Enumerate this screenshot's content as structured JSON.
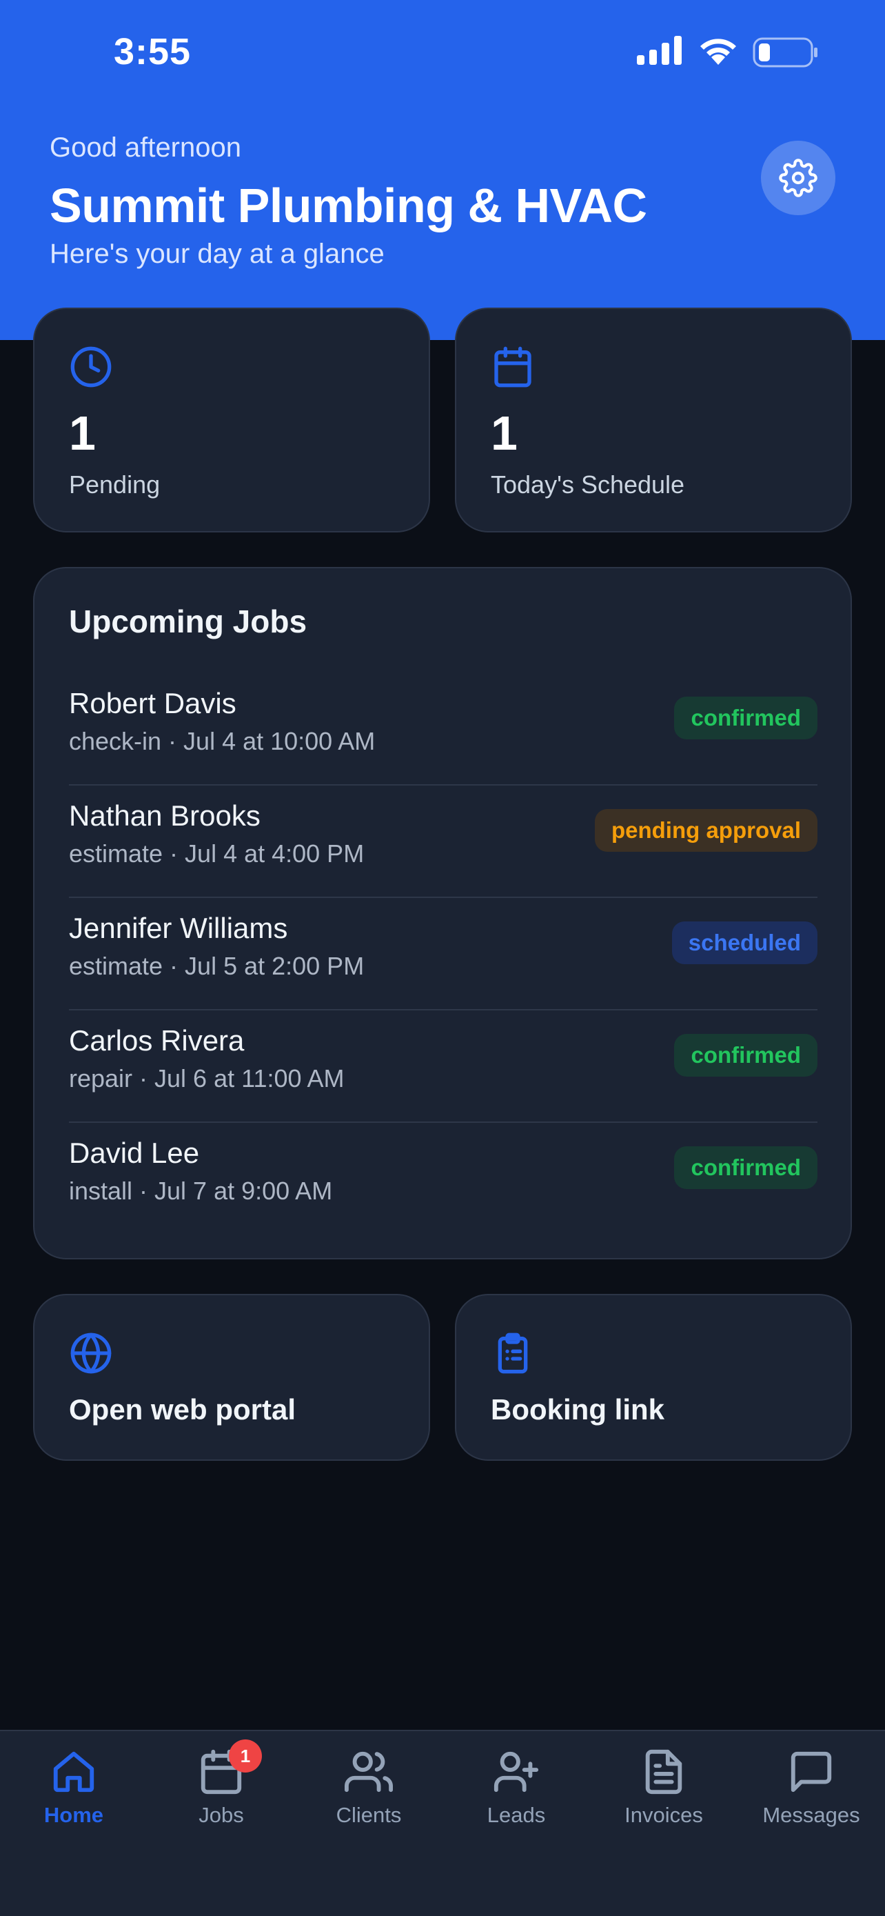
{
  "status_bar": {
    "time": "3:55"
  },
  "header": {
    "greeting": "Good afternoon",
    "business_name": "Summit Plumbing & HVAC",
    "subtitle": "Here's your day at a glance"
  },
  "stats": [
    {
      "icon": "clock-icon",
      "value": "1",
      "label": "Pending"
    },
    {
      "icon": "calendar-icon",
      "value": "1",
      "label": "Today's Schedule"
    }
  ],
  "upcoming_jobs": {
    "title": "Upcoming Jobs",
    "items": [
      {
        "name": "Robert Davis",
        "detail": "check-in · Jul 4 at 10:00 AM",
        "status": "confirmed"
      },
      {
        "name": "Nathan Brooks",
        "detail": "estimate · Jul 4 at 4:00 PM",
        "status": "pending approval"
      },
      {
        "name": "Jennifer Williams",
        "detail": "estimate · Jul 5 at 2:00 PM",
        "status": "scheduled"
      },
      {
        "name": "Carlos Rivera",
        "detail": "repair · Jul 6 at 11:00 AM",
        "status": "confirmed"
      },
      {
        "name": "David Lee",
        "detail": "install · Jul 7 at 9:00 AM",
        "status": "confirmed"
      }
    ]
  },
  "actions": [
    {
      "icon": "globe-icon",
      "label": "Open web portal"
    },
    {
      "icon": "clipboard-icon",
      "label": "Booking link"
    }
  ],
  "tabbar": {
    "items": [
      {
        "label": "Home",
        "icon": "home-icon",
        "active": true
      },
      {
        "label": "Jobs",
        "icon": "calendar-icon",
        "badge": "1"
      },
      {
        "label": "Clients",
        "icon": "users-icon"
      },
      {
        "label": "Leads",
        "icon": "user-plus-icon"
      },
      {
        "label": "Invoices",
        "icon": "document-icon"
      },
      {
        "label": "Messages",
        "icon": "chat-icon"
      }
    ]
  },
  "colors": {
    "brand": "#2563eb",
    "background": "#0b0f17",
    "card": "#1b2333",
    "confirmed": "#22c55e",
    "pending": "#f59e0b",
    "scheduled": "#3b76f2",
    "badge": "#ef4444"
  }
}
